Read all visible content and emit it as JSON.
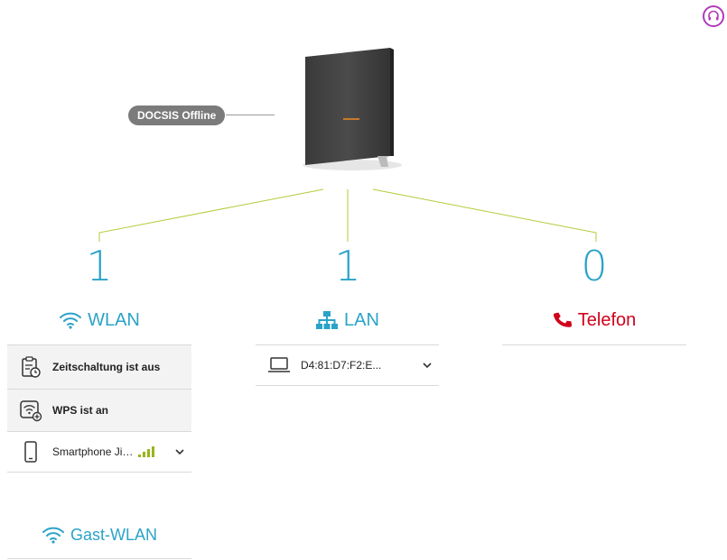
{
  "status": {
    "label": "DOCSIS Offline"
  },
  "wlan": {
    "count": "1",
    "title": "WLAN",
    "rows": [
      {
        "icon": "schedule-icon",
        "label": "Zeitschaltung ist aus"
      },
      {
        "icon": "wps-icon",
        "label": "WPS ist an"
      }
    ],
    "device": {
      "icon": "smartphone-icon",
      "label": "Smartphone Ji…",
      "signal_bars": 4
    }
  },
  "lan": {
    "count": "1",
    "title": "LAN",
    "device": {
      "icon": "laptop-icon",
      "label": "D4:81:D7:F2:E..."
    }
  },
  "telefon": {
    "count": "0",
    "title": "Telefon"
  },
  "guest": {
    "title": "Gast-WLAN"
  },
  "colors": {
    "accent": "#2aa3c8",
    "phone": "#d0021b",
    "help": "#b03ab8",
    "connector": "#b7c93a"
  }
}
